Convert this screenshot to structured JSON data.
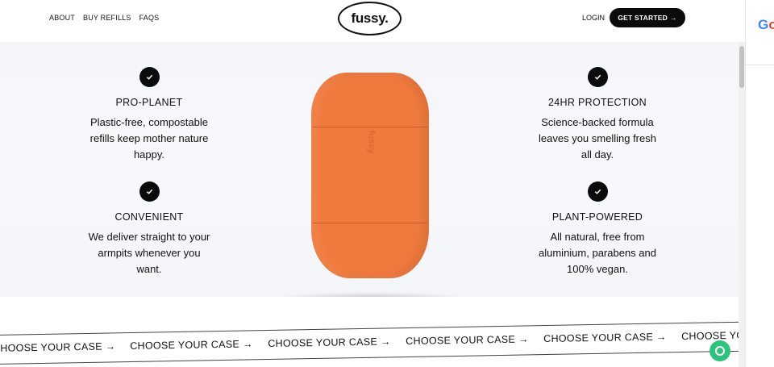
{
  "nav": {
    "about": "ABOUT",
    "buy_refills": "BUY REFILLS",
    "faqs": "FAQS",
    "logo": "fussy.",
    "login": "LOGIN",
    "get_started": "GET STARTED",
    "get_started_arrow": "→"
  },
  "features": [
    {
      "title": "PRO-PLANET",
      "lines": [
        "Plastic-free, compostable",
        "refills keep mother nature",
        "happy."
      ]
    },
    {
      "title": "24HR PROTECTION",
      "lines": [
        "Science-backed formula",
        "leaves you smelling fresh",
        "all day."
      ]
    },
    {
      "title": "CONVENIENT",
      "lines": [
        "We deliver straight to your",
        "armpits whenever you",
        "want."
      ]
    },
    {
      "title": "PLANT-POWERED",
      "lines": [
        "All natural, free from",
        "aluminium, parabens and",
        "100% vegan."
      ]
    }
  ],
  "product": {
    "emboss": "fussy"
  },
  "banner": {
    "items": [
      "HOOSE YOUR CASE →",
      "CHOOSE YOUR CASE →",
      "CHOOSE YOUR CASE →",
      "CHOOSE YOUR CASE →",
      "CHOOSE YOUR CASE →",
      "CHOOSE YOU"
    ]
  },
  "side_panel": {
    "letters": [
      "G",
      "o"
    ]
  },
  "colors": {
    "accent": "#0b0b0b",
    "product": "#f07a3e",
    "chat": "#2ec27e"
  },
  "icons": {
    "feature": "check-icon",
    "chat": "chat-icon"
  }
}
